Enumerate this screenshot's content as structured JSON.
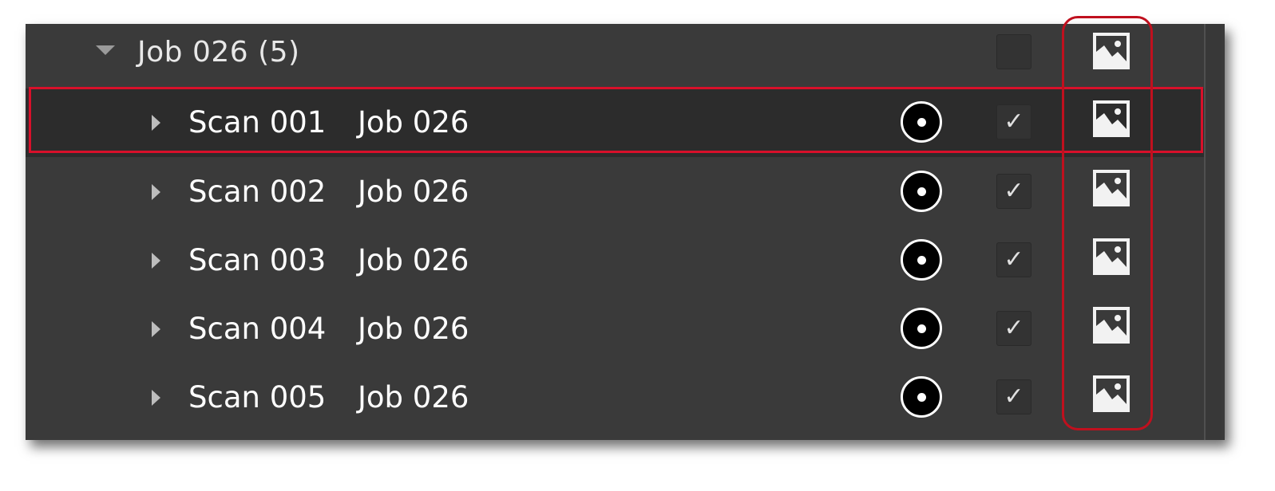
{
  "group": {
    "label": "Job 026 (5)",
    "expanded": true,
    "checked": false,
    "icon": "image-icon"
  },
  "rows": [
    {
      "name": "Scan 001",
      "job": "Job 026",
      "checked": true,
      "check_glyph": "✓",
      "selected": true
    },
    {
      "name": "Scan 002",
      "job": "Job 026",
      "checked": true,
      "check_glyph": "✓",
      "selected": false
    },
    {
      "name": "Scan 003",
      "job": "Job 026",
      "checked": true,
      "check_glyph": "✓",
      "selected": false
    },
    {
      "name": "Scan 004",
      "job": "Job 026",
      "checked": true,
      "check_glyph": "✓",
      "selected": false
    },
    {
      "name": "Scan 005",
      "job": "Job 026",
      "checked": true,
      "check_glyph": "✓",
      "selected": false
    }
  ],
  "icons": {
    "expand": "triangle-down-icon",
    "collapse": "triangle-right-icon",
    "target": "target-icon",
    "image": "image-icon"
  },
  "colors": {
    "panel_bg": "#3a3a3a",
    "selected_row_bg": "#2c2c2c",
    "selection_outline": "#d8102a",
    "annotation_outline": "#c0101e",
    "text": "#ffffff"
  }
}
